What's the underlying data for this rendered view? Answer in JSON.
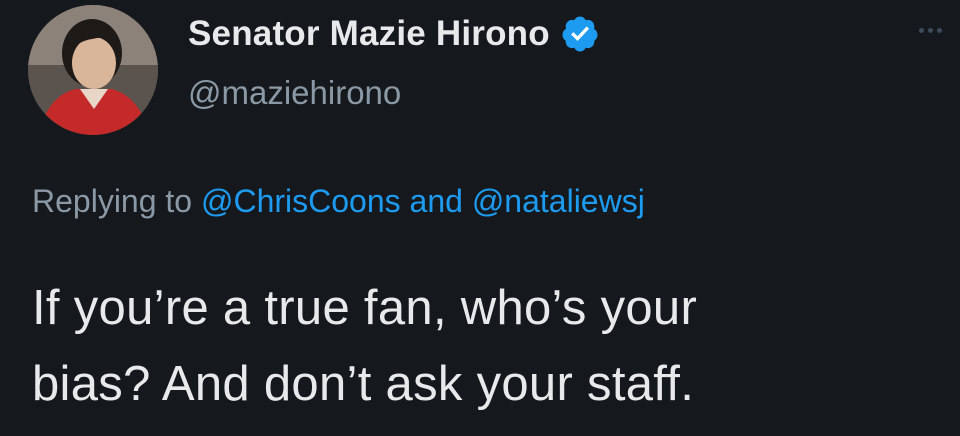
{
  "author": {
    "display_name": "Senator Mazie Hirono",
    "handle": "@maziehirono",
    "verified": true,
    "avatar_icon": "profile-photo",
    "verified_icon": "verified-badge-icon"
  },
  "reply": {
    "prefix": "Replying to",
    "mention_1": "@ChrisCoons",
    "joiner": "and",
    "mention_2": "@nataliewsj"
  },
  "tweet": {
    "line_1": "If you’re a true fan, who’s your",
    "line_2": "bias? And don’t ask your staff."
  },
  "colors": {
    "background": "#15181c",
    "text": "#e7e9ea",
    "secondary": "#8b98a5",
    "accent": "#1d9bf0"
  }
}
